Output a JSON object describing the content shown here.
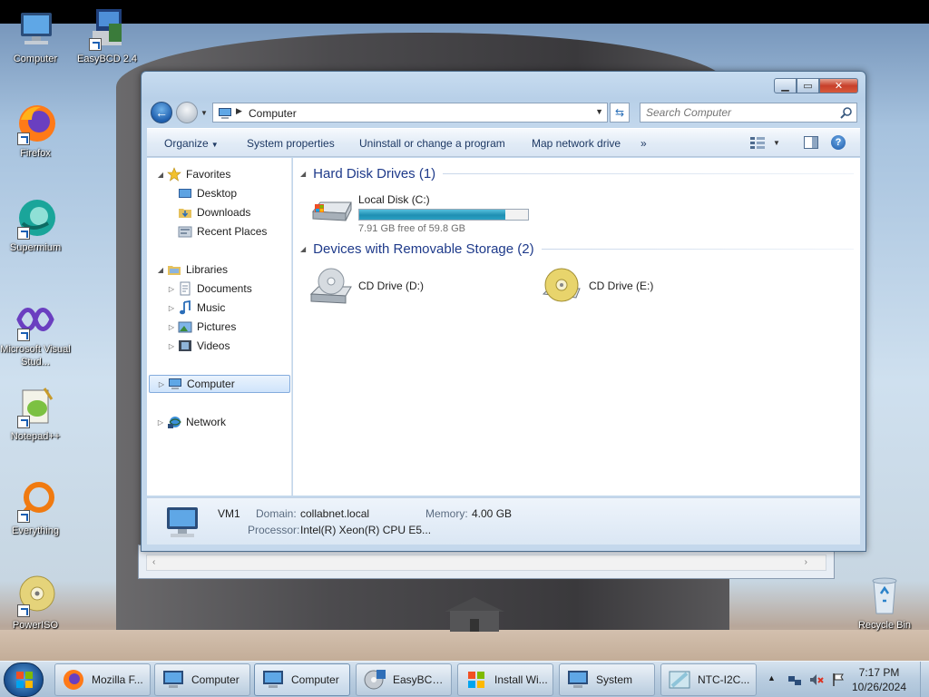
{
  "desktop": {
    "icons": [
      {
        "label": "Computer",
        "icon": "computer-icon"
      },
      {
        "label": "EasyBCD 2.4",
        "icon": "easybcd-icon"
      },
      {
        "label": "Firefox",
        "icon": "firefox-icon"
      },
      {
        "label": "Supermium",
        "icon": "supermium-icon"
      },
      {
        "label": "Microsoft Visual Stud...",
        "icon": "visual-studio-icon"
      },
      {
        "label": "Notepad++",
        "icon": "notepadpp-icon"
      },
      {
        "label": "Everything",
        "icon": "everything-icon"
      },
      {
        "label": "PowerISO",
        "icon": "poweriso-icon"
      },
      {
        "label": "Recycle Bin",
        "icon": "recycle-bin-icon"
      }
    ]
  },
  "window": {
    "address": {
      "crumb": "Computer"
    },
    "search": {
      "placeholder": "Search Computer"
    },
    "toolbar": {
      "organize": "Organize",
      "system_properties": "System properties",
      "uninstall": "Uninstall or change a program",
      "map_drive": "Map network drive",
      "more": "»"
    },
    "nav": {
      "favorites": "Favorites",
      "desktop": "Desktop",
      "downloads": "Downloads",
      "recent": "Recent Places",
      "libraries": "Libraries",
      "documents": "Documents",
      "music": "Music",
      "pictures": "Pictures",
      "videos": "Videos",
      "computer": "Computer",
      "network": "Network"
    },
    "content": {
      "hdd_header": "Hard Disk Drives (1)",
      "removable_header": "Devices with Removable Storage (2)",
      "drives": [
        {
          "name": "Local Disk (C:)",
          "free": "7.91 GB free of 59.8 GB",
          "used_fraction": 0.868
        }
      ],
      "removable": [
        {
          "name": "CD Drive (D:)"
        },
        {
          "name": "CD Drive (E:)"
        }
      ]
    },
    "details": {
      "name": "VM1",
      "domain_label": "Domain:",
      "domain": "collabnet.local",
      "memory_label": "Memory:",
      "memory": "4.00 GB",
      "processor_label": "Processor:",
      "processor": "Intel(R) Xeon(R) CPU E5..."
    }
  },
  "taskbar": {
    "tasks": [
      {
        "label": "Mozilla F...",
        "icon": "firefox-icon",
        "active": false
      },
      {
        "label": "Computer",
        "icon": "computer-icon",
        "active": false
      },
      {
        "label": "Computer",
        "icon": "computer-icon",
        "active": true
      },
      {
        "label": "EasyBCD ...",
        "icon": "easybcd-icon",
        "active": false
      },
      {
        "label": "Install Wi...",
        "icon": "windows-setup-icon",
        "active": false
      },
      {
        "label": "System",
        "icon": "computer-icon",
        "active": false
      },
      {
        "label": "NTC-I2C...",
        "icon": "window-app-icon",
        "active": false
      }
    ],
    "clock": {
      "time": "7:17 PM",
      "date": "10/26/2024"
    }
  },
  "colors": {
    "accent": "#1e3a8a",
    "drive_bar": "#1f8fb2",
    "close_button": "#c7402b"
  }
}
